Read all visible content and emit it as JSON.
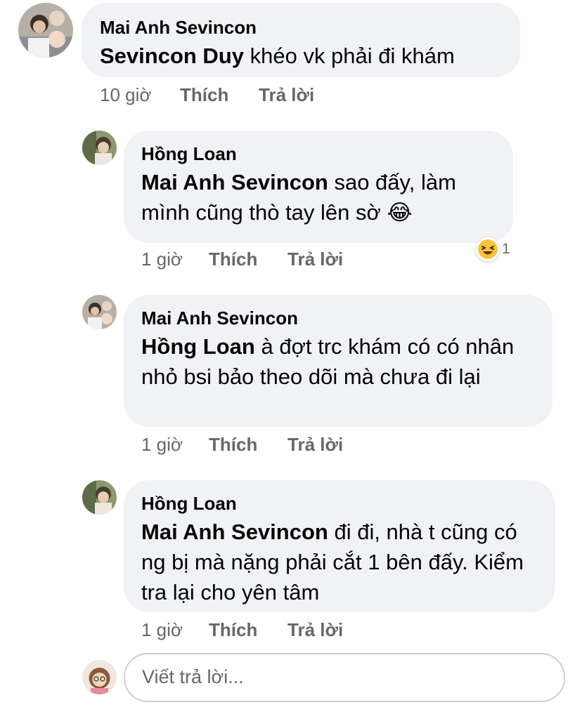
{
  "comments": [
    {
      "author": "Mai Anh Sevincon",
      "mention": "Sevincon Duy",
      "text": " khéo vk phải đi khám",
      "time": "10 giờ",
      "like_label": "Thích",
      "reply_label": "Trả lời"
    },
    {
      "author": "Hồng Loan",
      "mention": "Mai Anh Sevincon",
      "text": " sao đấy, làm mình cũng thò tay lên sờ 😂",
      "time": "1 giờ",
      "like_label": "Thích",
      "reply_label": "Trả lời",
      "reaction": {
        "icon": "laughing-face",
        "count": "1"
      }
    },
    {
      "author": "Mai Anh Sevincon",
      "mention": "Hồng Loan",
      "text": " à đợt trc khám có có nhân nhỏ bsi bảo theo dõi mà chưa đi lại",
      "time": "1 giờ",
      "like_label": "Thích",
      "reply_label": "Trả lời"
    },
    {
      "author": "Hồng Loan",
      "mention": "Mai Anh Sevincon",
      "text": " đi đi, nhà t cũng có ng bị mà nặng phải cắt 1 bên đấy. Kiểm tra lại cho yên tâm",
      "time": "1 giờ",
      "like_label": "Thích",
      "reply_label": "Trả lời"
    }
  ],
  "reply_input": {
    "placeholder": "Viết trả lời..."
  },
  "colors": {
    "bubble": "#f0f2f5",
    "meta": "#65676b",
    "text": "#050505"
  }
}
